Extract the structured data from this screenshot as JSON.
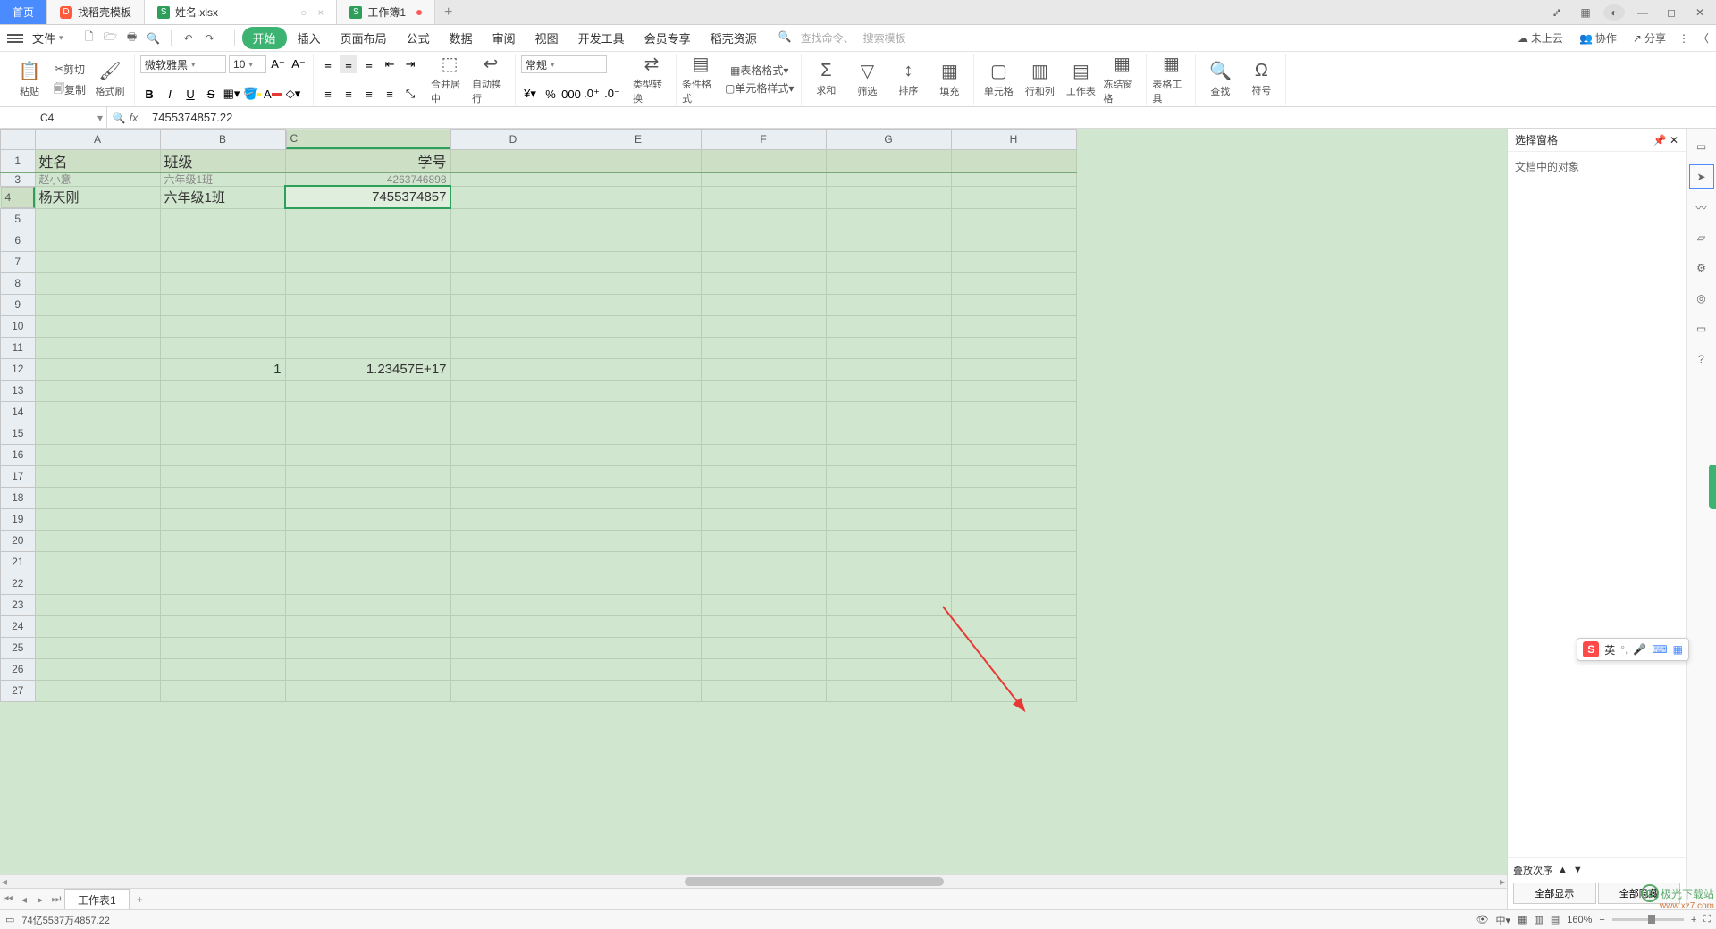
{
  "tabs": {
    "home": "首页",
    "template": "找稻壳模板",
    "file1": "姓名.xlsx",
    "file2": "工作簿1"
  },
  "file_menu": {
    "label": "文件"
  },
  "menu": {
    "start": "开始",
    "insert": "插入",
    "page": "页面布局",
    "formula": "公式",
    "data": "数据",
    "review": "审阅",
    "view": "视图",
    "dev": "开发工具",
    "vip": "会员专享",
    "res": "稻壳资源"
  },
  "search": {
    "cmd_placeholder": "查找命令、搜索模板",
    "cmd": "查找命令、",
    "tpl": "搜索模板"
  },
  "top_right": {
    "cloud": "未上云",
    "coop": "协作",
    "share": "分享"
  },
  "ribbon": {
    "paste": "粘贴",
    "cut": "剪切",
    "copy": "复制",
    "format_painter": "格式刷",
    "font_name": "微软雅黑",
    "font_size": "10",
    "merge": "合并居中",
    "wrap": "自动换行",
    "fmt_general": "常规",
    "type_convert": "类型转换",
    "cond_fmt": "条件格式",
    "table_style": "表格格式",
    "cell_style": "单元格样式",
    "sum": "求和",
    "filter": "筛选",
    "sort": "排序",
    "fill": "填充",
    "cell": "单元格",
    "rowcol": "行和列",
    "sheet": "工作表",
    "freeze": "冻结窗格",
    "tools": "表格工具",
    "find": "查找",
    "symbol": "符号"
  },
  "name_box": "C4",
  "formula": "7455374857.22",
  "cols": [
    "A",
    "B",
    "C",
    "D",
    "E",
    "F",
    "G",
    "H"
  ],
  "row_nums": [
    1,
    3,
    4,
    5,
    6,
    7,
    8,
    9,
    10,
    11,
    12,
    13,
    14,
    15,
    16,
    17,
    18,
    19,
    20,
    21,
    22,
    23,
    24,
    25,
    26,
    27
  ],
  "cells": {
    "r1": {
      "a": "姓名",
      "b": "班级",
      "c": "学号"
    },
    "r3": {
      "a": "赵小意",
      "b": "六年级1班",
      "c": "4263746898"
    },
    "r4": {
      "a": "杨天刚",
      "b": "六年级1班",
      "c": "7455374857"
    },
    "r12": {
      "b": "1",
      "c": "1.23457E+17"
    }
  },
  "side_panel": {
    "title": "选择窗格",
    "body_label": "文档中的对象",
    "order": "叠放次序",
    "show_all": "全部显示",
    "hide_all": "全部隐藏"
  },
  "sheet_tabs": {
    "s1": "工作表1"
  },
  "status": {
    "left": "74亿5537万4857.22",
    "zoom": "160%"
  },
  "ime": {
    "lang": "英"
  },
  "watermark": {
    "site": "极光下载站",
    "url": "www.xz7.com"
  },
  "col_widths": {
    "rownum": 38,
    "A": 140,
    "B": 140,
    "C": 185,
    "D": 140,
    "E": 140,
    "F": 140,
    "G": 140,
    "H": 140
  }
}
